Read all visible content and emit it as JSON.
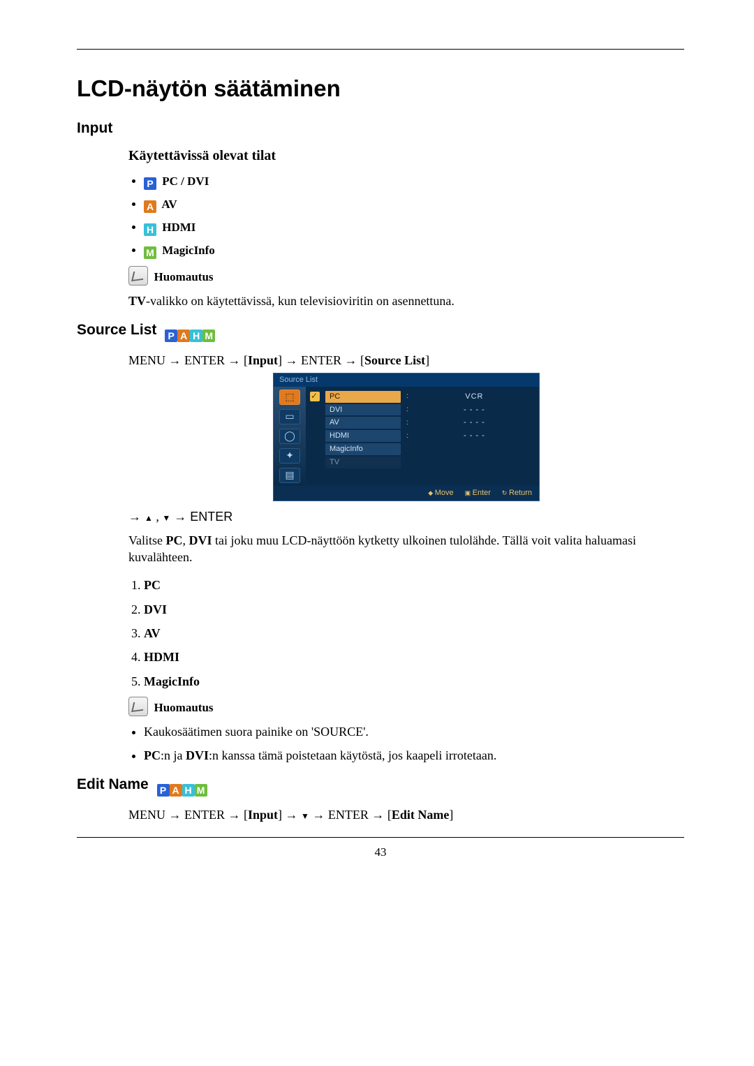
{
  "page_number": "43",
  "title": "LCD-näytön säätäminen",
  "sections": {
    "input": {
      "heading": "Input",
      "modes_heading": "Käytettävissä olevat tilat",
      "modes": [
        {
          "icon": "P",
          "label": "PC / DVI"
        },
        {
          "icon": "A",
          "label": "AV"
        },
        {
          "icon": "H",
          "label": "HDMI"
        },
        {
          "icon": "M",
          "label": "MagicInfo"
        }
      ],
      "note_label": "Huomautus",
      "note_text_prefix_bold": "TV",
      "note_text_rest": "-valikko on käytettävissä, kun televisioviritin on asennettuna."
    },
    "source_list": {
      "heading": "Source List",
      "path": {
        "p1": "MENU → ENTER → [",
        "b1": "Input",
        "p2": "] → ENTER → [",
        "b2": "Source List",
        "p3": "]"
      },
      "osd": {
        "title": "Source List",
        "items": [
          {
            "label": "PC",
            "value": "VCR",
            "selected": true,
            "check": true
          },
          {
            "label": "DVI",
            "value": "- - - -"
          },
          {
            "label": "AV",
            "value": "- - - -"
          },
          {
            "label": "HDMI",
            "value": "- - - -"
          },
          {
            "label": "MagicInfo",
            "value": ""
          },
          {
            "label": "TV",
            "value": "",
            "dim": true
          }
        ],
        "footer": {
          "move": "Move",
          "enter": "Enter",
          "return": "Return"
        }
      },
      "post_arrows": "→ ▲ , ▼ → ENTER",
      "para_prefix": "Valitse ",
      "para_b1": "PC",
      "para_mid1": ", ",
      "para_b2": "DVI",
      "para_rest": " tai joku muu LCD-näyttöön kytketty ulkoinen tulolähde. Tällä voit valita haluamasi kuvalähteen.",
      "ordered": [
        "PC",
        "DVI",
        "AV",
        "HDMI",
        "MagicInfo"
      ],
      "note_label": "Huomautus",
      "note_items": [
        {
          "text": "Kaukosäätimen suora painike on 'SOURCE'."
        },
        {
          "prefix_b1": "PC",
          "mid": ":n ja ",
          "b2": "DVI",
          "rest": ":n kanssa tämä poistetaan käytöstä, jos kaapeli irrotetaan."
        }
      ]
    },
    "edit_name": {
      "heading": "Edit Name",
      "path": {
        "p1": "MENU → ENTER → [",
        "b1": "Input",
        "p2": "] → ▼ → ENTER → [",
        "b2": "Edit Name",
        "p3": "]"
      }
    }
  }
}
